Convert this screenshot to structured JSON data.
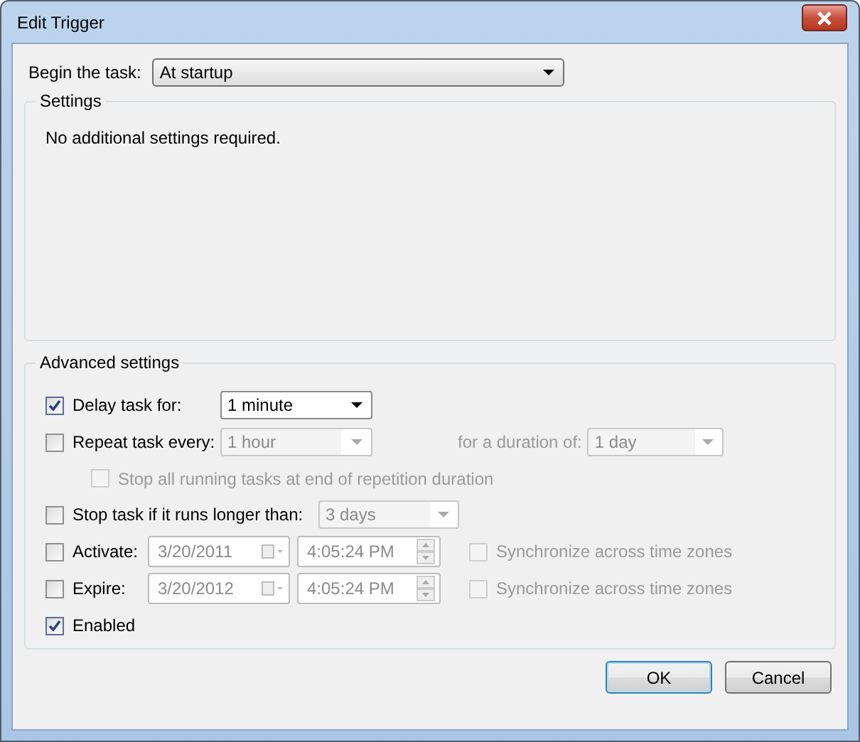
{
  "window": {
    "title": "Edit Trigger"
  },
  "begin": {
    "label": "Begin the task:",
    "value": "At startup"
  },
  "settings": {
    "title": "Settings",
    "message": "No additional settings required."
  },
  "advanced": {
    "title": "Advanced settings",
    "delay": {
      "label": "Delay task for:",
      "checked": true,
      "value": "1 minute"
    },
    "repeat": {
      "label": "Repeat task every:",
      "checked": false,
      "value": "1 hour",
      "duration_label": "for a duration of:",
      "duration_value": "1 day"
    },
    "stop_all": {
      "label": "Stop all running tasks at end of repetition duration",
      "checked": false
    },
    "stop_task": {
      "label": "Stop task if it runs longer than:",
      "checked": false,
      "value": "3 days"
    },
    "dates": [
      {
        "label": "Activate:",
        "checked": false,
        "date": "3/20/2011",
        "time": "4:05:24 PM",
        "sync_label": "Synchronize across time zones",
        "sync_checked": false
      },
      {
        "label": "Expire:",
        "checked": false,
        "date": "3/20/2012",
        "time": "4:05:24 PM",
        "sync_label": "Synchronize across time zones",
        "sync_checked": false
      }
    ],
    "enabled": {
      "label": "Enabled",
      "checked": true
    }
  },
  "buttons": [
    {
      "label": "OK",
      "default": true
    },
    {
      "label": "Cancel",
      "default": false
    }
  ]
}
